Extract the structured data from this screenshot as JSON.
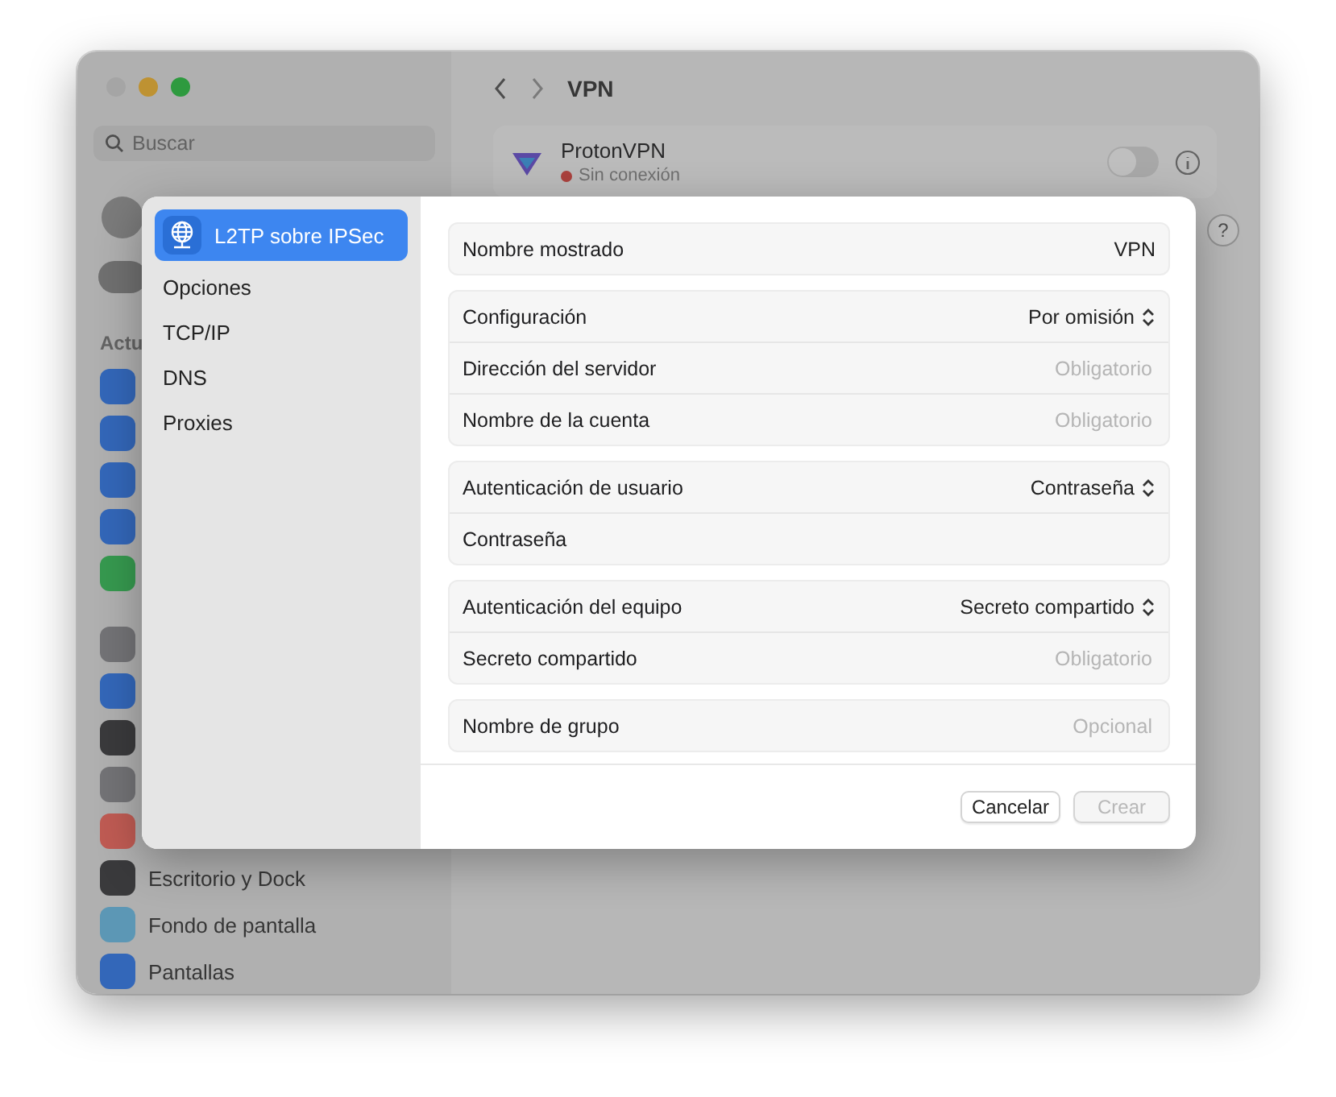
{
  "window": {
    "search": {
      "placeholder": "Buscar"
    },
    "sidebar": {
      "section": "Actu",
      "items": [
        {
          "label": "Escritorio y Dock"
        },
        {
          "label": "Fondo de pantalla"
        },
        {
          "label": "Pantallas"
        }
      ]
    },
    "title": "VPN",
    "vpn": {
      "name": "ProtonVPN",
      "status": "Sin conexión",
      "on": false
    },
    "help": "?"
  },
  "dialog": {
    "nav": [
      {
        "label": "L2TP sobre IPSec",
        "selected": true,
        "kind": "service"
      },
      {
        "label": "Opciones",
        "selected": false
      },
      {
        "label": "TCP/IP",
        "selected": false
      },
      {
        "label": "DNS",
        "selected": false
      },
      {
        "label": "Proxies",
        "selected": false
      }
    ],
    "groups": [
      [
        {
          "label": "Nombre mostrado",
          "kind": "value",
          "value": "VPN"
        }
      ],
      [
        {
          "label": "Configuración",
          "kind": "popup",
          "value": "Por omisión"
        },
        {
          "label": "Dirección del servidor",
          "kind": "field",
          "placeholder": "Obligatorio"
        },
        {
          "label": "Nombre de la cuenta",
          "kind": "field",
          "placeholder": "Obligatorio"
        }
      ],
      [
        {
          "label": "Autenticación de usuario",
          "kind": "popup",
          "value": "Contraseña"
        },
        {
          "label": "Contraseña",
          "kind": "field"
        }
      ],
      [
        {
          "label": "Autenticación del equipo",
          "kind": "popup",
          "value": "Secreto compartido"
        },
        {
          "label": "Secreto compartido",
          "kind": "field",
          "placeholder": "Obligatorio"
        }
      ],
      [
        {
          "label": "Nombre de grupo",
          "kind": "field",
          "placeholder": "Opcional"
        }
      ]
    ],
    "buttons": [
      {
        "label": "Cancelar",
        "disabled": false
      },
      {
        "label": "Crear",
        "disabled": true
      }
    ]
  }
}
